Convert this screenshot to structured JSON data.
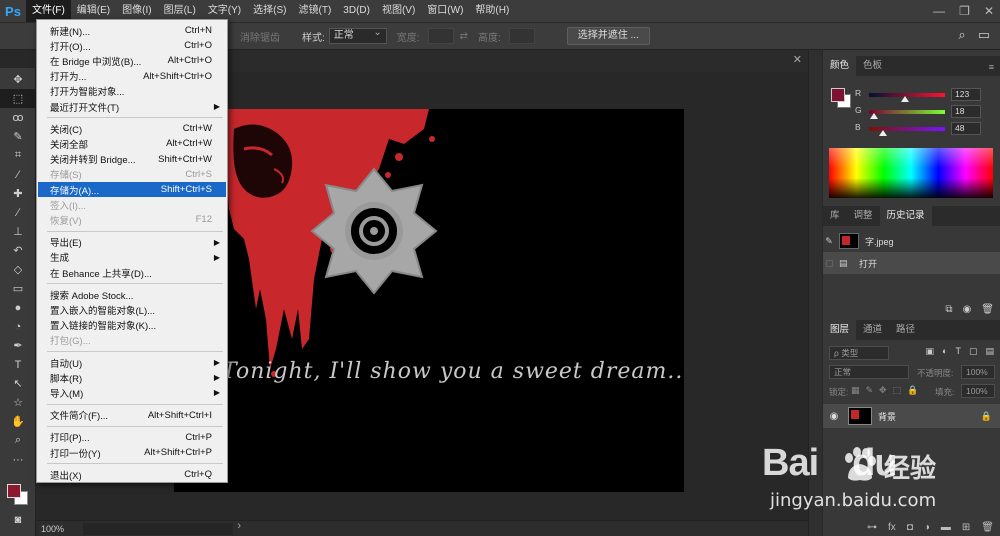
{
  "app": {
    "logo": "Ps"
  },
  "menubar": {
    "items": [
      "文件(F)",
      "编辑(E)",
      "图像(I)",
      "图层(L)",
      "文字(Y)",
      "选择(S)",
      "滤镜(T)",
      "3D(D)",
      "视图(V)",
      "窗口(W)",
      "帮助(H)"
    ]
  },
  "window_controls": {
    "minimize": "—",
    "restore": "❐",
    "close": "✕"
  },
  "options_bar": {
    "feather_label": "消除锯齿",
    "style_label": "样式:",
    "style_value": "正常",
    "width_label": "宽度:",
    "height_label": "高度:",
    "select_mask_button": "选择并遮住 ..."
  },
  "file_menu": {
    "items": [
      {
        "label": "新建(N)...",
        "shortcut": "Ctrl+N",
        "state": "normal"
      },
      {
        "label": "打开(O)...",
        "shortcut": "Ctrl+O",
        "state": "normal"
      },
      {
        "label": "在 Bridge 中浏览(B)...",
        "shortcut": "Alt+Ctrl+O",
        "state": "normal"
      },
      {
        "label": "打开为...",
        "shortcut": "Alt+Shift+Ctrl+O",
        "state": "normal"
      },
      {
        "label": "打开为智能对象...",
        "shortcut": "",
        "state": "normal"
      },
      {
        "label": "最近打开文件(T)",
        "shortcut": "",
        "state": "submenu"
      },
      {
        "label": "关闭(C)",
        "shortcut": "Ctrl+W",
        "state": "normal"
      },
      {
        "label": "关闭全部",
        "shortcut": "Alt+Ctrl+W",
        "state": "normal"
      },
      {
        "label": "关闭并转到 Bridge...",
        "shortcut": "Shift+Ctrl+W",
        "state": "normal"
      },
      {
        "label": "存储(S)",
        "shortcut": "Ctrl+S",
        "state": "disabled"
      },
      {
        "label": "存储为(A)...",
        "shortcut": "Shift+Ctrl+S",
        "state": "highlight"
      },
      {
        "label": "签入(I)...",
        "shortcut": "",
        "state": "disabled"
      },
      {
        "label": "恢复(V)",
        "shortcut": "F12",
        "state": "disabled"
      },
      {
        "label": "导出(E)",
        "shortcut": "",
        "state": "submenu"
      },
      {
        "label": "生成",
        "shortcut": "",
        "state": "submenu"
      },
      {
        "label": "在 Behance 上共享(D)...",
        "shortcut": "",
        "state": "normal"
      },
      {
        "label": "搜索 Adobe Stock...",
        "shortcut": "",
        "state": "normal"
      },
      {
        "label": "置入嵌入的智能对象(L)...",
        "shortcut": "",
        "state": "normal"
      },
      {
        "label": "置入链接的智能对象(K)...",
        "shortcut": "",
        "state": "normal"
      },
      {
        "label": "打包(G)...",
        "shortcut": "",
        "state": "disabled"
      },
      {
        "label": "自动(U)",
        "shortcut": "",
        "state": "submenu"
      },
      {
        "label": "脚本(R)",
        "shortcut": "",
        "state": "submenu"
      },
      {
        "label": "导入(M)",
        "shortcut": "",
        "state": "submenu"
      },
      {
        "label": "文件简介(F)...",
        "shortcut": "Alt+Shift+Ctrl+I",
        "state": "normal"
      },
      {
        "label": "打印(P)...",
        "shortcut": "Ctrl+P",
        "state": "normal"
      },
      {
        "label": "打印一份(Y)",
        "shortcut": "Alt+Shift+Ctrl+P",
        "state": "normal"
      },
      {
        "label": "退出(X)",
        "shortcut": "Ctrl+Q",
        "state": "normal"
      }
    ]
  },
  "canvas": {
    "text": "Tonight, I'll show you a sweet dream..."
  },
  "status": {
    "zoom": "100%"
  },
  "color_panel": {
    "tabs": [
      "颜色",
      "色板"
    ],
    "channels": [
      {
        "name": "R",
        "value": "123",
        "fraction": 0.48,
        "color_from": "#001233",
        "color_to": "#ff1233"
      },
      {
        "name": "G",
        "value": "18",
        "fraction": 0.07,
        "color_from": "#7b0033",
        "color_to": "#7bff33"
      },
      {
        "name": "B",
        "value": "48",
        "fraction": 0.19,
        "color_from": "#7b1200",
        "color_to": "#7b12ff"
      }
    ],
    "foreground": "#7b1230"
  },
  "history_panel": {
    "tabs": [
      "库",
      "调整",
      "历史记录"
    ],
    "snapshot_name": "字.jpeg",
    "steps": [
      "打开"
    ]
  },
  "layers_panel": {
    "tabs": [
      "图层",
      "通道",
      "路径"
    ],
    "filter_placeholder": "ρ 类型",
    "blend_mode": "正常",
    "opacity_label": "不透明度:",
    "opacity_value": "100%",
    "lock_label": "锁定:",
    "fill_label": "填充:",
    "fill_value": "100%",
    "layer_name": "背景"
  },
  "watermark": {
    "logo": "Bai",
    "logo_tail": "du",
    "cn": "经验",
    "url": "jingyan.baidu.com"
  }
}
